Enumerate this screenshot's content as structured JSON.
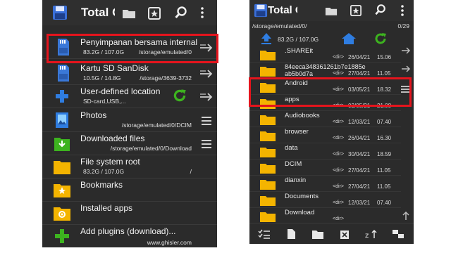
{
  "left": {
    "title": "Total Commander",
    "rows": [
      {
        "title": "Penyimpanan bersama internal",
        "size": "83.2G / 107.0G",
        "path": "/storage/emulated/0",
        "icon": "sd-card-icon"
      },
      {
        "title": "Kartu SD SanDisk",
        "size": "10.5G / 14.8G",
        "path": "/storage/3639-3732",
        "icon": "sd-card-icon"
      },
      {
        "title": "User-defined location",
        "size": "SD-card,USB,...",
        "path": "",
        "icon": "plus-icon"
      },
      {
        "title": "Photos",
        "size": "",
        "path": "/storage/emulated/0/DCIM",
        "icon": "photos-icon"
      },
      {
        "title": "Downloaded files",
        "size": "",
        "path": "/storage/emulated/0/Download",
        "icon": "download-icon"
      },
      {
        "title": "File system root",
        "size": "83.2G / 107.0G",
        "path": "/",
        "icon": "folder-icon"
      },
      {
        "title": "Bookmarks",
        "size": "",
        "path": "",
        "icon": "bookmark-folder-icon"
      },
      {
        "title": "Installed apps",
        "size": "",
        "path": "",
        "icon": "apps-folder-icon"
      },
      {
        "title": "Add plugins (download)...",
        "size": "",
        "path": "www.ghisler.com",
        "icon": "add-plugin-icon"
      }
    ]
  },
  "right": {
    "title": "Total Commander",
    "path": "/storage/emulated/0/",
    "count": "0/29",
    "storage": "83.2G / 107.0G",
    "rows": [
      {
        "name": ".SHAREit",
        "type": "<dir>",
        "date": "26/04/21",
        "time": "15.06"
      },
      {
        "name": "84eeca348361261b7e1885eab5b0d7a",
        "type": "<dir>",
        "date": "27/04/21",
        "time": "11.05"
      },
      {
        "name": "Android",
        "type": "<dir>",
        "date": "03/05/21",
        "time": "18.32"
      },
      {
        "name": "apps",
        "type": "<dir>",
        "date": "02/05/21",
        "time": "21.08"
      },
      {
        "name": "Audiobooks",
        "type": "<dir>",
        "date": "12/03/21",
        "time": "07.40"
      },
      {
        "name": "browser",
        "type": "<dir>",
        "date": "26/04/21",
        "time": "16.30"
      },
      {
        "name": "data",
        "type": "<dir>",
        "date": "30/04/21",
        "time": "18.59"
      },
      {
        "name": "DCIM",
        "type": "<dir>",
        "date": "27/04/21",
        "time": "11.05"
      },
      {
        "name": "dianxin",
        "type": "<dir>",
        "date": "27/04/21",
        "time": "11.05"
      },
      {
        "name": "Documents",
        "type": "<dir>",
        "date": "12/03/21",
        "time": "07.40"
      },
      {
        "name": "Download",
        "type": "<dir>",
        "date": "",
        "time": ""
      }
    ]
  },
  "colors": {
    "highlight": "#e5141d",
    "folder": "#f4b400",
    "accent_blue": "#2f7de1",
    "accent_green": "#3db31f"
  }
}
